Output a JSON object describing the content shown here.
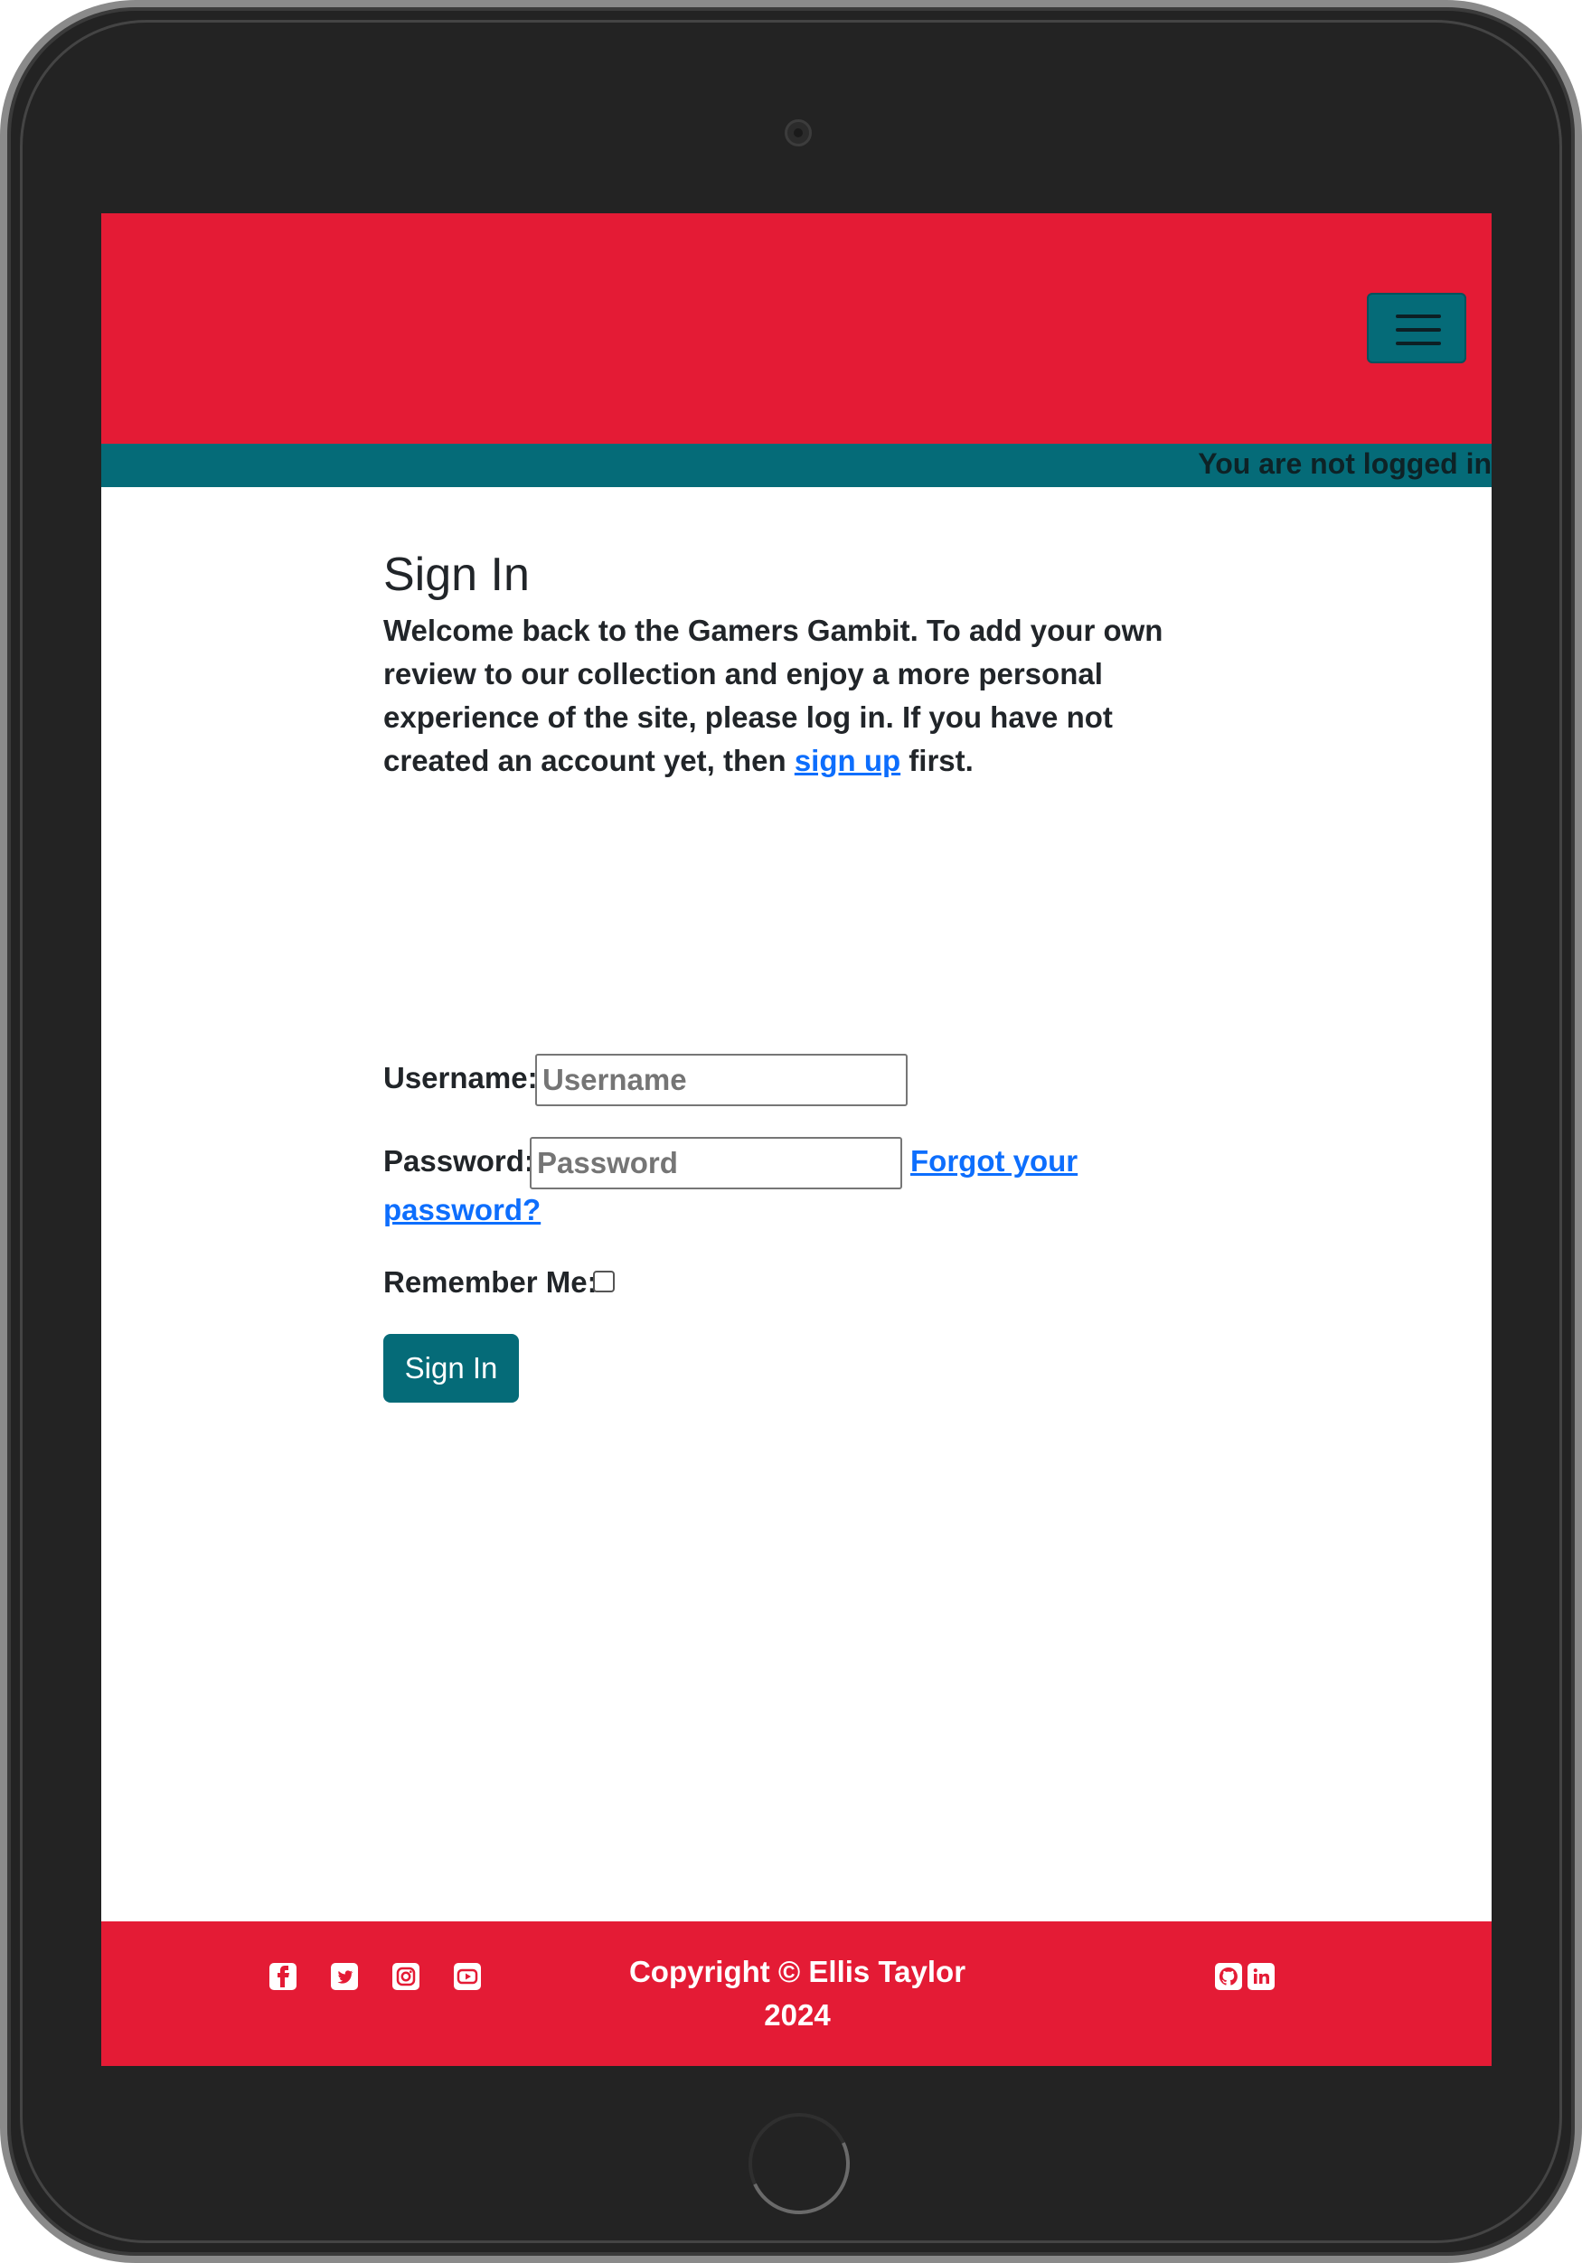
{
  "status": {
    "text": "You are not logged in"
  },
  "page": {
    "title": "Sign In",
    "intro_before": "Welcome back to the Gamers Gambit. To add your own review to our collection and enjoy a more personal experience of the site, please log in. If you have not created an account yet, then ",
    "intro_link": "sign up",
    "intro_after": " first."
  },
  "form": {
    "username_label": "Username:",
    "username_placeholder": "Username",
    "username_value": "",
    "password_label": "Password:",
    "password_placeholder": "Password",
    "password_value": "",
    "forgot_line1": "Forgot your",
    "forgot_line2": "password?",
    "remember_label": "Remember Me:",
    "remember_checked": false,
    "submit_label": "Sign In"
  },
  "footer": {
    "copyright_line1": "Copyright © Ellis Taylor",
    "copyright_line2": "2024",
    "social_left": [
      "facebook-icon",
      "twitter-icon",
      "instagram-icon",
      "youtube-icon"
    ],
    "social_right": [
      "github-icon",
      "linkedin-icon"
    ]
  },
  "colors": {
    "brand_red": "#e41b35",
    "brand_teal": "#056b78",
    "link_blue": "#0d6efd"
  }
}
